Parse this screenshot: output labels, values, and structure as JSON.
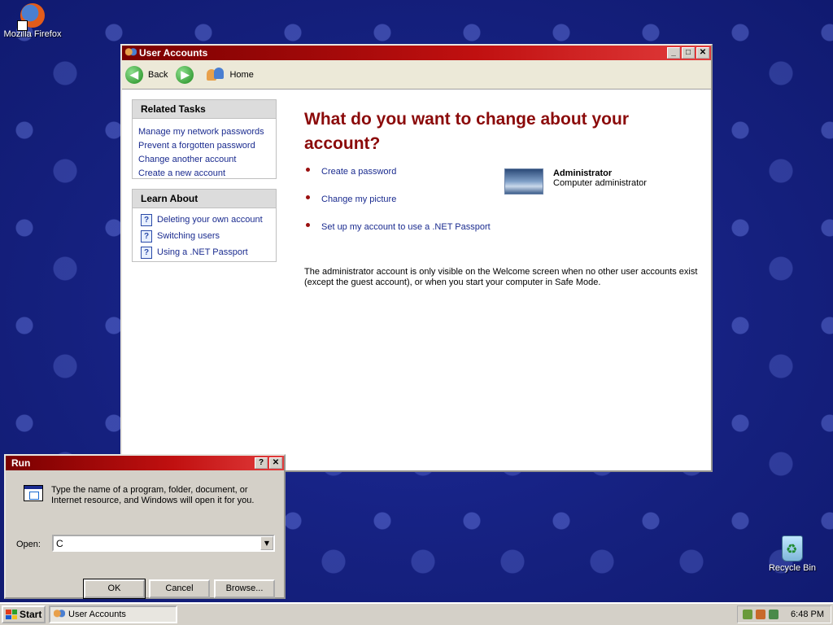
{
  "desktop": {
    "icons": [
      {
        "label": "Mozilla Firefox",
        "icon": "firefox-icon"
      },
      {
        "label": "Recycle Bin",
        "icon": "recycle-bin-icon"
      }
    ]
  },
  "user_accounts": {
    "title": "User Accounts",
    "toolbar": {
      "back": "Back",
      "forward_icon": "forward-arrow-icon",
      "home": "Home"
    },
    "related_tasks": {
      "heading": "Related Tasks",
      "links": [
        "Manage my network passwords",
        "Prevent a forgotten password",
        "Change another account",
        "Create a new account"
      ]
    },
    "learn_about": {
      "heading": "Learn About",
      "links": [
        "Deleting your own account",
        "Switching users",
        "Using a .NET Passport"
      ]
    },
    "main": {
      "heading": "What do you want to change about your account?",
      "tasks": [
        "Create a password",
        "Change my picture",
        "Set up my account to use a .NET Passport"
      ],
      "account": {
        "name": "Administrator",
        "role": "Computer administrator"
      },
      "info": "The administrator account is only visible on the Welcome screen when no other user accounts exist (except the guest account), or when you start your computer in Safe Mode."
    }
  },
  "run_dialog": {
    "title": "Run",
    "description": "Type the name of a program, folder, document, or Internet resource, and Windows will open it for you.",
    "open_label": "Open:",
    "open_value": "C",
    "buttons": {
      "ok": "OK",
      "cancel": "Cancel",
      "browse": "Browse..."
    }
  },
  "taskbar": {
    "start": "Start",
    "task": "User Accounts",
    "time": "6:48 PM"
  },
  "colors": {
    "title_bar": "#c01010",
    "heading": "#8b0a0a",
    "link": "#1a2b8f",
    "desktop": "#15207e"
  }
}
